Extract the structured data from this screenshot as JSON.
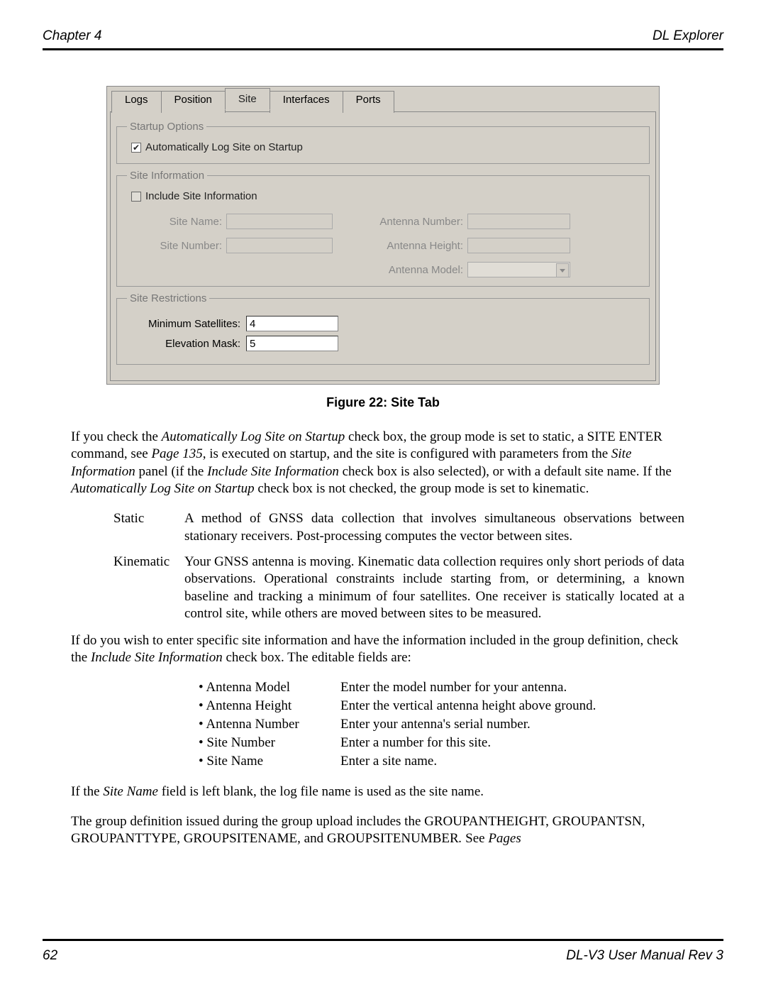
{
  "header": {
    "left": "Chapter 4",
    "right": "DL Explorer"
  },
  "footer": {
    "left": "62",
    "right": "DL-V3 User Manual Rev 3"
  },
  "figure_caption": "Figure 22: Site Tab",
  "dialog": {
    "tabs": [
      "Logs",
      "Position",
      "Site",
      "Interfaces",
      "Ports"
    ],
    "active_tab_index": 2,
    "startup_options": {
      "legend": "Startup Options",
      "auto_log_label": "Automatically Log Site on Startup",
      "auto_log_checked": true
    },
    "site_info": {
      "legend": "Site Information",
      "include_label": "Include Site Information",
      "include_checked": false,
      "labels": {
        "site_name": "Site Name:",
        "site_number": "Site Number:",
        "ant_number": "Antenna Number:",
        "ant_height": "Antenna Height:",
        "ant_model": "Antenna Model:"
      }
    },
    "site_restrictions": {
      "legend": "Site Restrictions",
      "min_sat_label": "Minimum Satellites:",
      "min_sat_value": "4",
      "elev_mask_label": "Elevation Mask:",
      "elev_mask_value": "5"
    }
  },
  "paragraphs": {
    "p1_a": "If you check the ",
    "p1_b": "Automatically Log Site on Startup",
    "p1_c": " check box, the group mode is set to static, a SITE ENTER command, see ",
    "p1_d": "Page 135",
    "p1_e": ", is executed on startup, and the site is configured with parameters from the ",
    "p1_f": "Site Information",
    "p1_g": " panel (if the ",
    "p1_h": "Include Site Information",
    "p1_i": " check box is also selected), or with a default site name. If the ",
    "p1_j": "Automatically Log Site on Startup",
    "p1_k": " check box is not checked, the group mode is set to kinematic.",
    "static_term": "Static",
    "static_desc": "A method of GNSS data collection that involves simultaneous observations between stationary receivers. Post-processing computes the vector between sites.",
    "kin_term": "Kinematic",
    "kin_desc": "Your GNSS antenna is moving. Kinematic data collection requires only short periods of data observations. Operational constraints include starting from, or determining, a known baseline and tracking a minimum of four satellites. One receiver is statically located at a control site, while others are moved between sites to be measured.",
    "p2_a": "If do you wish to enter specific site information and have the information included in the group definition, check the ",
    "p2_b": "Include Site Information",
    "p2_c": " check box. The editable fields are:",
    "fields": [
      {
        "label": "• Antenna Model",
        "desc": "Enter the model number for your antenna."
      },
      {
        "label": "• Antenna Height",
        "desc": "Enter the vertical antenna height above ground."
      },
      {
        "label": "• Antenna Number",
        "desc": "Enter your antenna's serial number."
      },
      {
        "label": "• Site Number",
        "desc": "Enter a number for this site."
      },
      {
        "label": "• Site Name",
        "desc": "Enter a site name."
      }
    ],
    "p3_a": "If the ",
    "p3_b": "Site Name",
    "p3_c": " field is left blank, the log file name is used as the site name.",
    "p4_a": "The group definition issued during the group upload includes the GROUPANTHEIGHT, GROUPANTSN, GROUPANTTYPE, GROUPSITENAME, and GROUPSITENUMBER",
    "p4_b": ". ",
    "p4_c": "See ",
    "p4_d": "Pages"
  }
}
